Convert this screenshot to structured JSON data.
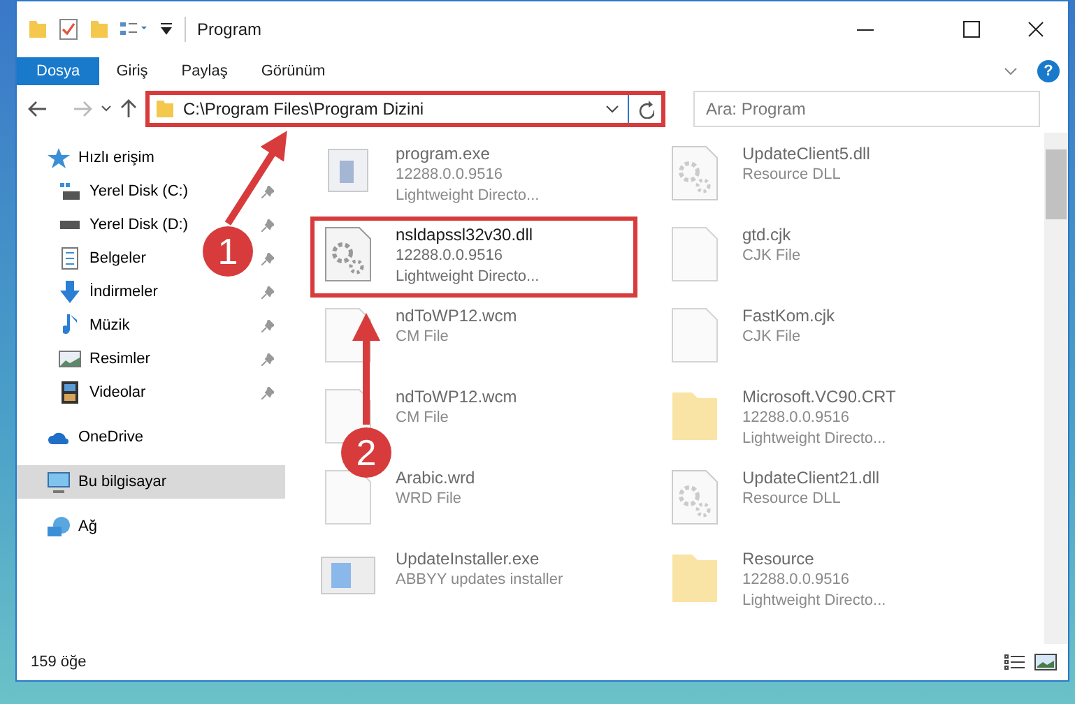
{
  "window": {
    "title": "Program"
  },
  "ribbon": {
    "tabs": [
      {
        "label": "Dosya",
        "selected": true
      },
      {
        "label": "Giriş",
        "selected": false
      },
      {
        "label": "Paylaş",
        "selected": false
      },
      {
        "label": "Görünüm",
        "selected": false
      }
    ],
    "help": "?"
  },
  "address_bar": {
    "path": "C:\\Program Files\\Program Dizini",
    "highlighted": true
  },
  "search": {
    "placeholder": "Ara: Program"
  },
  "sidebar": {
    "items": [
      {
        "label": "Hızlı erişim",
        "kind": "star",
        "selected": false,
        "children": [
          {
            "label": "Yerel Disk (C:)",
            "kind": "drive-c",
            "pinned": true,
            "selected": false
          },
          {
            "label": "Yerel Disk (D:)",
            "kind": "drive",
            "pinned": true,
            "selected": false
          },
          {
            "label": "Belgeler",
            "kind": "document",
            "pinned": true,
            "selected": false
          },
          {
            "label": "İndirmeler",
            "kind": "download",
            "pinned": true,
            "selected": false
          },
          {
            "label": "Müzik",
            "kind": "music",
            "pinned": true,
            "selected": false
          },
          {
            "label": "Resimler",
            "kind": "picture",
            "pinned": true,
            "selected": false
          },
          {
            "label": "Videolar",
            "kind": "film",
            "pinned": true,
            "selected": false
          }
        ]
      },
      {
        "label": "OneDrive",
        "kind": "cloud",
        "selected": false
      },
      {
        "label": "Bu bilgisayar",
        "kind": "computer",
        "selected": true
      },
      {
        "label": "Ağ",
        "kind": "network",
        "selected": false
      }
    ]
  },
  "files": [
    {
      "kind": "exe",
      "lines": [
        "program.exe",
        "12288.0.0.9516",
        "Lightweight Directo..."
      ],
      "blurred": true,
      "highlighted": false
    },
    {
      "kind": "dll",
      "lines": [
        "UpdateClient5.dll",
        "Resource DLL"
      ],
      "blurred": true,
      "highlighted": false
    },
    {
      "kind": "dll",
      "lines": [
        "nsldapssl32v30.dll",
        "12288.0.0.9516",
        "Lightweight Directo..."
      ],
      "blurred": false,
      "highlighted": true
    },
    {
      "kind": "blank",
      "lines": [
        "gtd.cjk",
        "CJK File"
      ],
      "blurred": true,
      "highlighted": false
    },
    {
      "kind": "blank",
      "lines": [
        "ndToWP12.wcm",
        "CM File"
      ],
      "blurred": true,
      "highlighted": false
    },
    {
      "kind": "blank",
      "lines": [
        "FastKom.cjk",
        "CJK File"
      ],
      "blurred": true,
      "highlighted": false
    },
    {
      "kind": "blank",
      "lines": [
        "ndToWP12.wcm",
        "CM File"
      ],
      "blurred": true,
      "highlighted": false
    },
    {
      "kind": "folder",
      "lines": [
        "Microsoft.VC90.CRT",
        "12288.0.0.9516",
        "Lightweight Directo..."
      ],
      "blurred": true,
      "highlighted": false
    },
    {
      "kind": "blank",
      "lines": [
        "Arabic.wrd",
        "WRD File"
      ],
      "blurred": true,
      "highlighted": false
    },
    {
      "kind": "dll",
      "lines": [
        "UpdateClient21.dll",
        "Resource DLL"
      ],
      "blurred": true,
      "highlighted": false
    },
    {
      "kind": "installer",
      "lines": [
        "UpdateInstaller.exe",
        "ABBYY updates installer"
      ],
      "blurred": true,
      "highlighted": false
    },
    {
      "kind": "folder",
      "lines": [
        "Resource",
        "12288.0.0.9516",
        "Lightweight Directo..."
      ],
      "blurred": true,
      "highlighted": false
    }
  ],
  "status_bar": {
    "item_count": "159 öğe"
  },
  "annotations": [
    {
      "number": "1"
    },
    {
      "number": "2"
    }
  ]
}
